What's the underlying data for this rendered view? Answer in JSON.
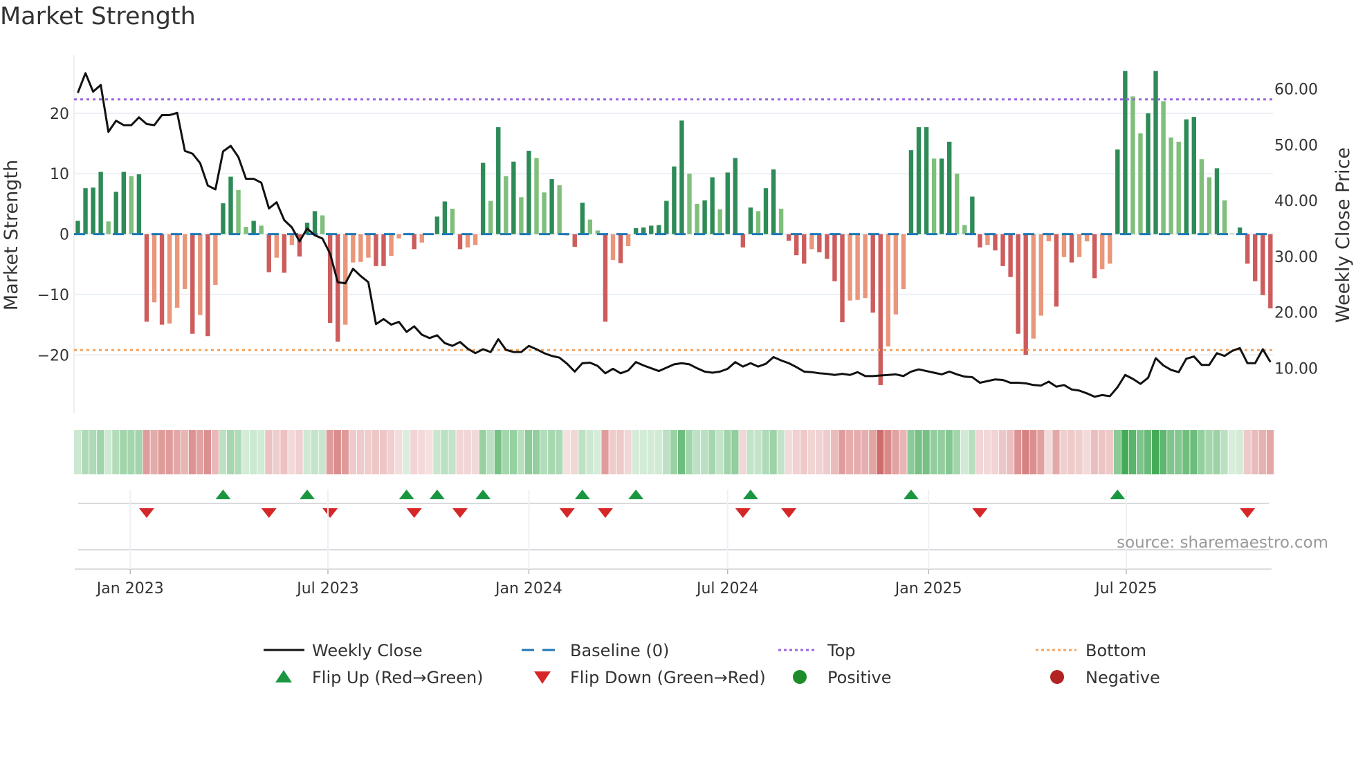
{
  "chart_data": {
    "type": "bar",
    "title": "Market Strength",
    "ylabel": "Market Strength",
    "y2label": "Weekly Close Price",
    "first_week": "2022-11-14",
    "interval_days": 7,
    "ylim": [
      -29.7,
      29.6
    ],
    "y2lim": [
      1.9,
      66.0
    ],
    "yticks": [
      20,
      10,
      0,
      -10,
      -20
    ],
    "ytick_labels": [
      "20",
      "10",
      "0",
      "−10",
      "−20"
    ],
    "y2ticks": [
      60,
      50,
      40,
      30,
      20,
      10
    ],
    "y2tick_labels": [
      "60.00",
      "50.00",
      "40.00",
      "30.00",
      "20.00",
      "10.00"
    ],
    "xticks": [
      {
        "date": "2023-01-01",
        "label": "Jan 2023"
      },
      {
        "date": "2023-07-01",
        "label": "Jul 2023"
      },
      {
        "date": "2024-01-01",
        "label": "Jan 2024"
      },
      {
        "date": "2024-07-01",
        "label": "Jul 2024"
      },
      {
        "date": "2025-01-01",
        "label": "Jan 2025"
      },
      {
        "date": "2025-07-01",
        "label": "Jul 2025"
      }
    ],
    "top_level": 22.3,
    "bottom_level": -19.2,
    "baseline": 0,
    "strength": [
      2.2,
      7.6,
      7.7,
      10.3,
      2.1,
      7,
      10.3,
      9.6,
      9.9,
      -14.5,
      -11.3,
      -15,
      -14.8,
      -12.2,
      -9.1,
      -16.5,
      -13.4,
      -16.9,
      -8.4,
      5.1,
      9.5,
      7.3,
      1.2,
      2.2,
      1.4,
      -6.3,
      -3.9,
      -6.4,
      -1.8,
      -3.7,
      1.9,
      3.8,
      3.1,
      -14.7,
      -17.8,
      -15,
      -4.7,
      -4.6,
      -3.9,
      -5.3,
      -5.3,
      -3.6,
      -0.7,
      0.1,
      -2.5,
      -1.4,
      -0.1,
      2.9,
      5.4,
      4.2,
      -2.5,
      -2.2,
      -1.8,
      11.8,
      5.5,
      17.7,
      9.6,
      12,
      6.1,
      13.8,
      12.6,
      6.9,
      9.1,
      8.1,
      -0.2,
      -2.1,
      5.2,
      2.4,
      0.6,
      -14.5,
      -4.3,
      -4.8,
      -2,
      1,
      1.1,
      1.4,
      1.5,
      5.5,
      11.2,
      18.8,
      10,
      5,
      5.6,
      9.4,
      4.1,
      10.2,
      12.6,
      -2.2,
      4.4,
      3.8,
      7.6,
      10.7,
      4.2,
      -1.1,
      -3.5,
      -4.9,
      -2.5,
      -3,
      -4.1,
      -7.8,
      -14.6,
      -11,
      -10.9,
      -10.6,
      -13,
      -25,
      -18.6,
      -13.3,
      -9.1,
      13.9,
      17.7,
      17.7,
      12.5,
      12.5,
      15.3,
      10,
      1.5,
      6.2,
      -2.2,
      -1.8,
      -2.7,
      -5.3,
      -7.1,
      -16.5,
      -20,
      -17.3,
      -13.5,
      -1.2,
      -12,
      -3.8,
      -4.7,
      -3.8,
      -1.2,
      -7.3,
      -5.8,
      -4.9,
      14,
      27,
      22.8,
      16.7,
      20,
      27,
      22,
      16,
      15.3,
      19,
      19.4,
      12.4,
      9.4,
      10.9,
      5.6,
      0.1,
      1.1,
      -4.9,
      -7.8,
      -10.1,
      -12.3
    ],
    "weekly_close": [
      59.3,
      62.8,
      59.5,
      60.7,
      52.3,
      54.3,
      53.5,
      53.5,
      54.9,
      53.7,
      53.5,
      55.3,
      55.3,
      55.7,
      48.9,
      48.4,
      46.7,
      42.7,
      42.0,
      48.8,
      49.8,
      47.8,
      43.9,
      43.9,
      43.2,
      38.6,
      39.7,
      36.5,
      35.2,
      32.7,
      35.0,
      33.8,
      33.2,
      30.5,
      25.4,
      25.2,
      27.8,
      26.5,
      25.4,
      17.9,
      18.8,
      17.8,
      18.3,
      16.5,
      17.5,
      16.0,
      15.4,
      15.9,
      14.5,
      14.0,
      14.7,
      13.5,
      12.7,
      13.4,
      12.9,
      15.2,
      13.3,
      12.9,
      12.9,
      14.0,
      13.4,
      12.7,
      12.2,
      11.9,
      10.8,
      9.4,
      10.9,
      11.0,
      10.4,
      9.1,
      9.9,
      9.1,
      9.6,
      11.1,
      10.5,
      10.0,
      9.5,
      10.1,
      10.7,
      10.9,
      10.7,
      10.0,
      9.4,
      9.2,
      9.4,
      9.9,
      11.1,
      10.3,
      10.9,
      10.3,
      10.8,
      12.0,
      11.4,
      10.9,
      10.2,
      9.4,
      9.3,
      9.1,
      9.0,
      8.8,
      9.0,
      8.8,
      9.3,
      8.6,
      8.6,
      8.7,
      8.8,
      8.9,
      8.6,
      9.4,
      9.8,
      9.5,
      9.2,
      8.9,
      9.4,
      8.9,
      8.5,
      8.4,
      7.4,
      7.7,
      8.0,
      7.9,
      7.4,
      7.4,
      7.3,
      7.0,
      6.9,
      7.6,
      6.7,
      7.0,
      6.2,
      6.0,
      5.5,
      4.9,
      5.2,
      5.0,
      6.6,
      8.8,
      8.1,
      7.2,
      8.3,
      11.8,
      10.5,
      9.7,
      9.3,
      11.7,
      12.1,
      10.6,
      10.6,
      12.7,
      12.2,
      13.1,
      13.6,
      10.9,
      10.9,
      13.4,
      11.1
    ],
    "legend": {
      "placement": "bottom",
      "weekly_close": "Weekly Close",
      "baseline": "Baseline (0)",
      "top": "Top",
      "bottom": "Bottom",
      "flip_up": "Flip Up (Red→Green)",
      "flip_down": "Flip Down (Green→Red)",
      "positive": "Positive",
      "negative": "Negative"
    },
    "source": "source: sharemaestro.com"
  },
  "colors": {
    "pos_dark": "#2e8b57",
    "pos_light": "#7fbf7b",
    "neg_dark": "#cd5c5c",
    "neg_light": "#e9967a",
    "price": "#111111",
    "baseline": "#1f77b4",
    "top": "#9966dd",
    "bottom": "#f4a460",
    "flip_up": "#1a9641",
    "flip_down": "#d62728",
    "positive": "#1e8c2a",
    "negative": "#b22222",
    "grid": "#eceff5"
  }
}
